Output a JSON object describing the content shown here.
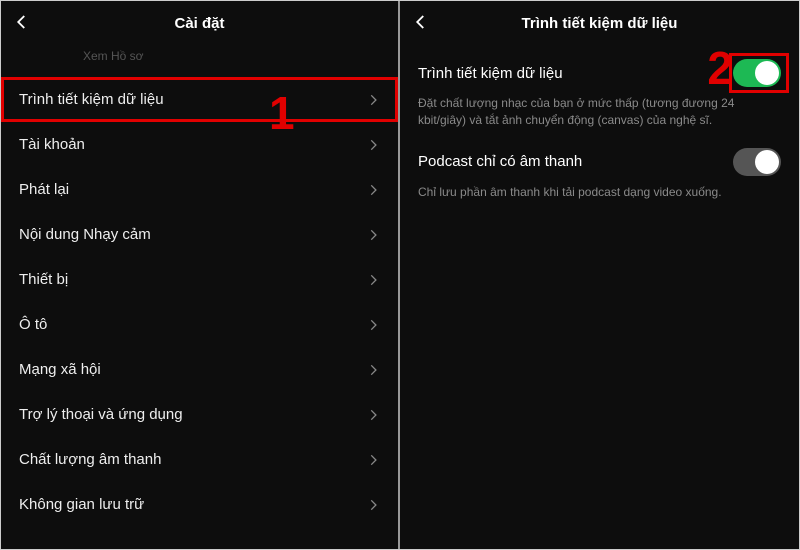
{
  "left": {
    "title": "Cài đặt",
    "faded_text": "Xem Hồ sơ",
    "callout": "1",
    "items": [
      {
        "label": "Trình tiết kiệm dữ liệu",
        "highlight": true
      },
      {
        "label": "Tài khoản"
      },
      {
        "label": "Phát lại"
      },
      {
        "label": "Nội dung Nhạy cảm"
      },
      {
        "label": "Thiết bị"
      },
      {
        "label": "Ô tô"
      },
      {
        "label": "Mạng xã hội"
      },
      {
        "label": "Trợ lý thoại và ứng dụng"
      },
      {
        "label": "Chất lượng âm thanh"
      },
      {
        "label": "Không gian lưu trữ"
      }
    ]
  },
  "right": {
    "title": "Trình tiết kiệm dữ liệu",
    "callout": "2",
    "sections": [
      {
        "title": "Trình tiết kiệm dữ liệu",
        "desc": "Đặt chất lượng nhạc của bạn ở mức thấp (tương đương 24 kbit/giây) và tắt ảnh chuyển động (canvas) của nghệ sĩ.",
        "toggle_on": true,
        "highlight": true
      },
      {
        "title": "Podcast chỉ có âm thanh",
        "desc": "Chỉ lưu phần âm thanh khi tải podcast dạng video xuống.",
        "toggle_on": false
      }
    ]
  }
}
